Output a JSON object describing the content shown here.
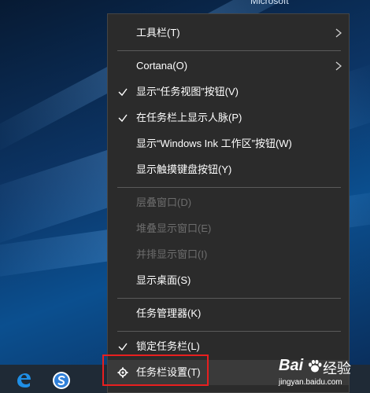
{
  "desktop": {
    "top_label": "Microsoft"
  },
  "menu": {
    "items": [
      {
        "label": "工具栏(T)",
        "checked": false,
        "has_submenu": true,
        "enabled": true
      },
      {
        "label": "Cortana(O)",
        "checked": false,
        "has_submenu": true,
        "enabled": true
      },
      {
        "label": "显示“任务视图”按钮(V)",
        "checked": true,
        "has_submenu": false,
        "enabled": true
      },
      {
        "label": "在任务栏上显示人脉(P)",
        "checked": true,
        "has_submenu": false,
        "enabled": true
      },
      {
        "label": "显示“Windows Ink 工作区”按钮(W)",
        "checked": false,
        "has_submenu": false,
        "enabled": true
      },
      {
        "label": "显示触摸键盘按钮(Y)",
        "checked": false,
        "has_submenu": false,
        "enabled": true
      },
      {
        "label": "层叠窗口(D)",
        "checked": false,
        "has_submenu": false,
        "enabled": false
      },
      {
        "label": "堆叠显示窗口(E)",
        "checked": false,
        "has_submenu": false,
        "enabled": false
      },
      {
        "label": "并排显示窗口(I)",
        "checked": false,
        "has_submenu": false,
        "enabled": false
      },
      {
        "label": "显示桌面(S)",
        "checked": false,
        "has_submenu": false,
        "enabled": true
      },
      {
        "label": "任务管理器(K)",
        "checked": false,
        "has_submenu": false,
        "enabled": true
      },
      {
        "label": "锁定任务栏(L)",
        "checked": true,
        "has_submenu": false,
        "enabled": true
      },
      {
        "label": "任务栏设置(T)",
        "checked": false,
        "has_submenu": false,
        "enabled": true,
        "icon": "gear-icon",
        "highlighted": true
      }
    ]
  },
  "taskbar": {
    "icons": [
      "edge-icon",
      "sogou-browser-icon"
    ]
  },
  "watermark": {
    "brand": "Bai",
    "brand_suffix": "经验",
    "url": "jingyan.baidu.com"
  },
  "colors": {
    "menu_bg": "#2b2b2b",
    "highlight": "#e81f1f",
    "disabled_text": "#6d6d6d"
  }
}
